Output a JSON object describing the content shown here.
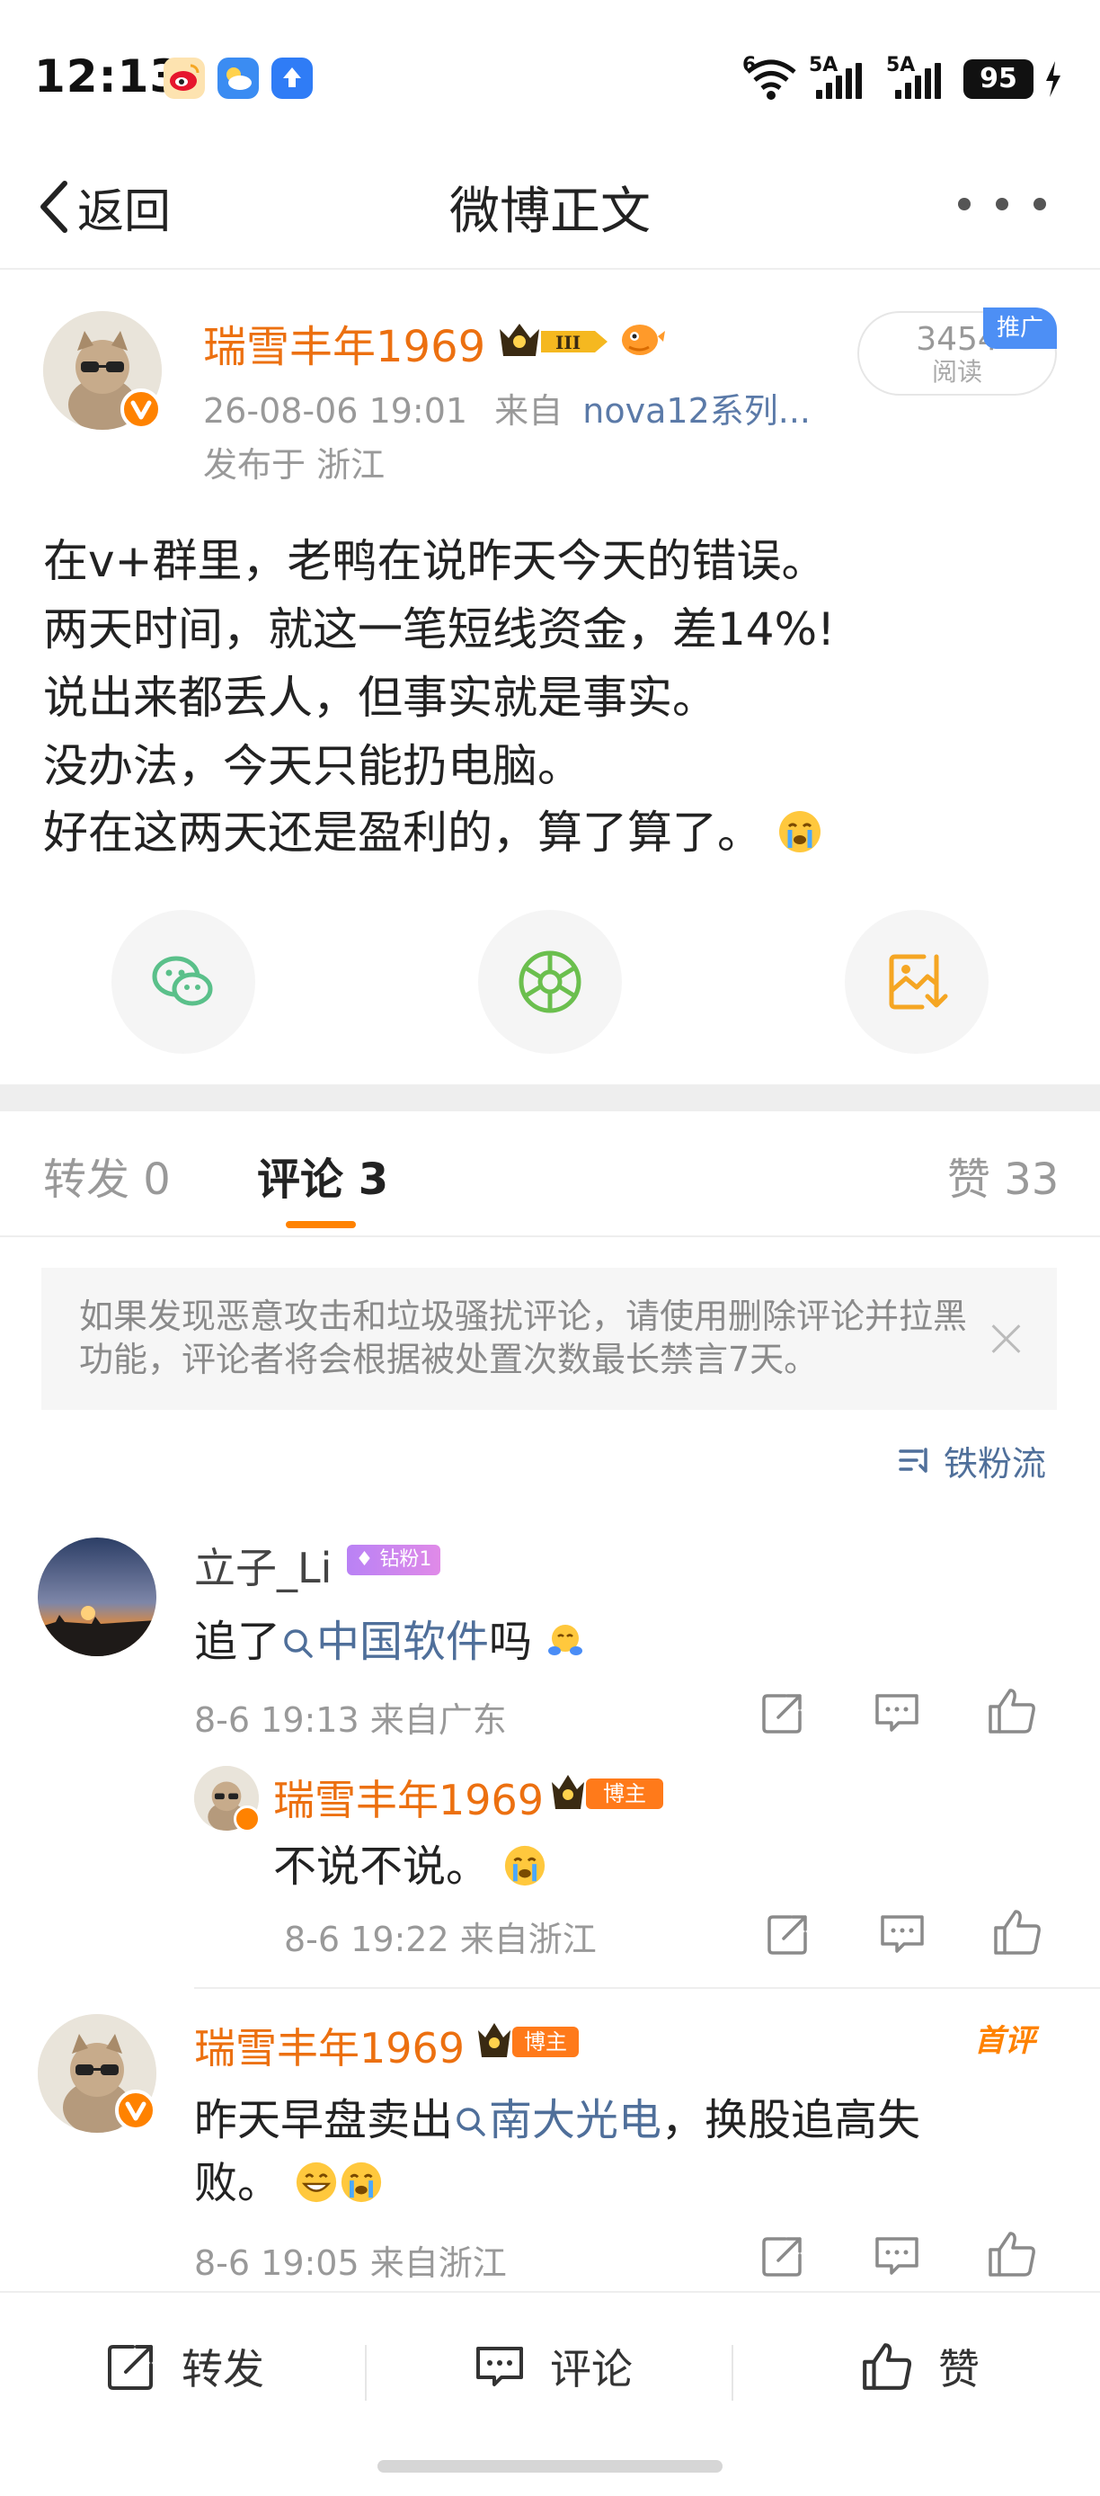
{
  "status_bar": {
    "time": "12:13",
    "battery": "95",
    "signal_1": "5A",
    "signal_2": "5A",
    "wifi": "6"
  },
  "nav": {
    "back_label": "返回",
    "title": "微博正文"
  },
  "post": {
    "author": "瑞雪丰年1969",
    "time": "26-08-06 19:01",
    "source_prefix": "来自",
    "source": "nova12系列...",
    "region": "发布于 浙江",
    "reads_count": "3454",
    "reads_label": "阅读",
    "promo_label": "推广",
    "lines": [
      "在v+群里，老鸭在说昨天今天的错误。",
      "两天时间，就这一笔短线资金，差14%!",
      "说出来都丢人，但事实就是事实。",
      "没办法，今天只能扔电脑。",
      "好在这两天还是盈利的，算了算了。"
    ]
  },
  "tabs": {
    "repost": "转发 0",
    "comments": "评论 3",
    "likes": "赞 33"
  },
  "notice": "如果发现恶意攻击和垃圾骚扰评论，请使用删除评论并拉黑功能，评论者将会根据被处置次数最长禁言7天。",
  "sort_label": "铁粉流",
  "comments": [
    {
      "name": "立子_Li",
      "badge": "钻粉1",
      "text_prefix": "追了",
      "link": "中国软件",
      "text_suffix": "吗",
      "meta": "8-6 19:13 来自广东",
      "reply": {
        "name": "瑞雪丰年1969",
        "badge": "博主",
        "text": "不说不说。",
        "meta": "8-6 19:22 来自浙江"
      }
    },
    {
      "name": "瑞雪丰年1969",
      "badge": "博主",
      "tag": "首评",
      "text_prefix": "昨天早盘卖出",
      "link": "南大光电",
      "text_suffix": "，换股追高失",
      "text_line2": "败。",
      "meta": "8-6 19:05 来自浙江"
    }
  ],
  "bottom_bar": {
    "repost": "转发",
    "comment": "评论",
    "like": "赞"
  },
  "colors": {
    "accent_orange": "#ff8200",
    "name_orange": "#ec7010",
    "link_blue": "#4f6f9a",
    "wechat_green": "#5ac08a"
  }
}
